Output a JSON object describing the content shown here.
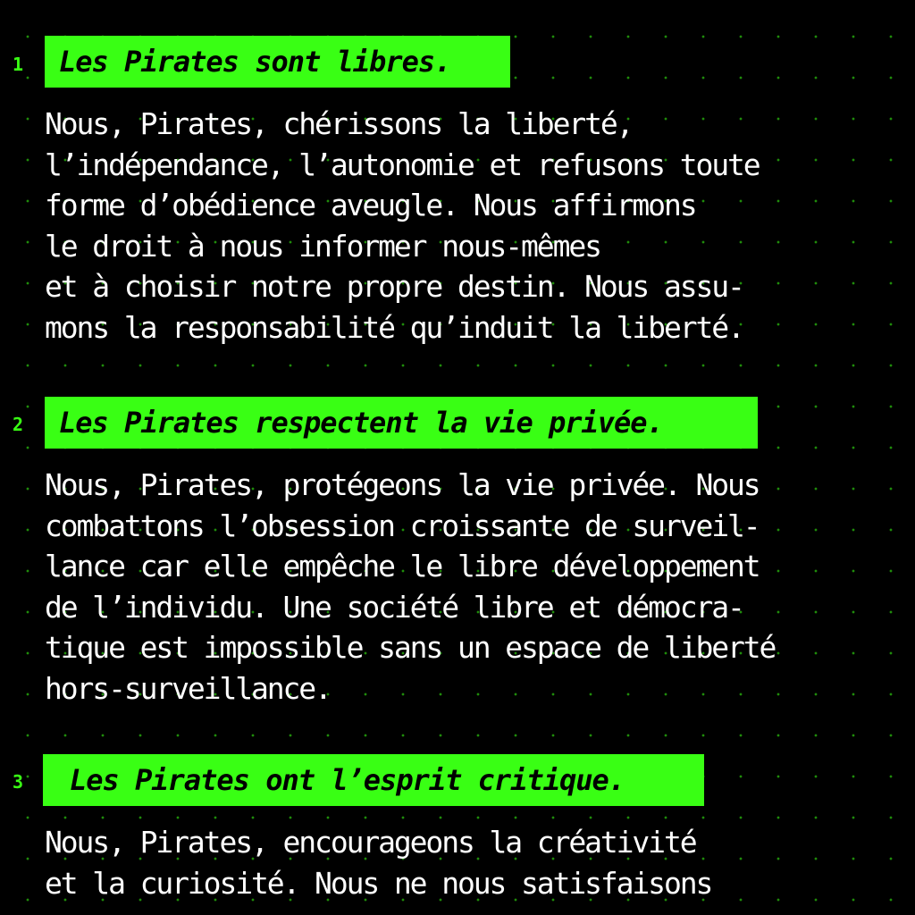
{
  "colors": {
    "accent": "#39ff14",
    "background": "#000000",
    "text": "#ffffff",
    "heading_text": "#000000"
  },
  "sections": [
    {
      "number": "1",
      "heading": "Les Pirates sont libres.",
      "lines": [
        "Nous, Pirates, chérissons la liberté,",
        "l’indépendance, l’autonomie et refusons toute",
        "forme d’obédience aveugle. Nous affirmons",
        "le droit à nous informer nous-mêmes",
        "et à choisir notre propre destin. Nous assu-",
        "mons la responsabilité qu’induit la liberté."
      ]
    },
    {
      "number": "2",
      "heading": "Les Pirates respectent la vie privée.",
      "lines": [
        "Nous, Pirates, protégeons la vie privée. Nous",
        "combattons l’obsession croissante de surveil-",
        "lance car elle empêche le libre développement",
        "de l’individu. Une société libre et démocra-",
        "tique est impossible sans un espace de liberté",
        "hors-surveillance."
      ]
    },
    {
      "number": "3",
      "heading": "Les Pirates ont l’esprit critique.",
      "lines": [
        "Nous, Pirates, encourageons la créativité",
        "et la curiosité. Nous ne nous satisfaisons"
      ]
    }
  ]
}
